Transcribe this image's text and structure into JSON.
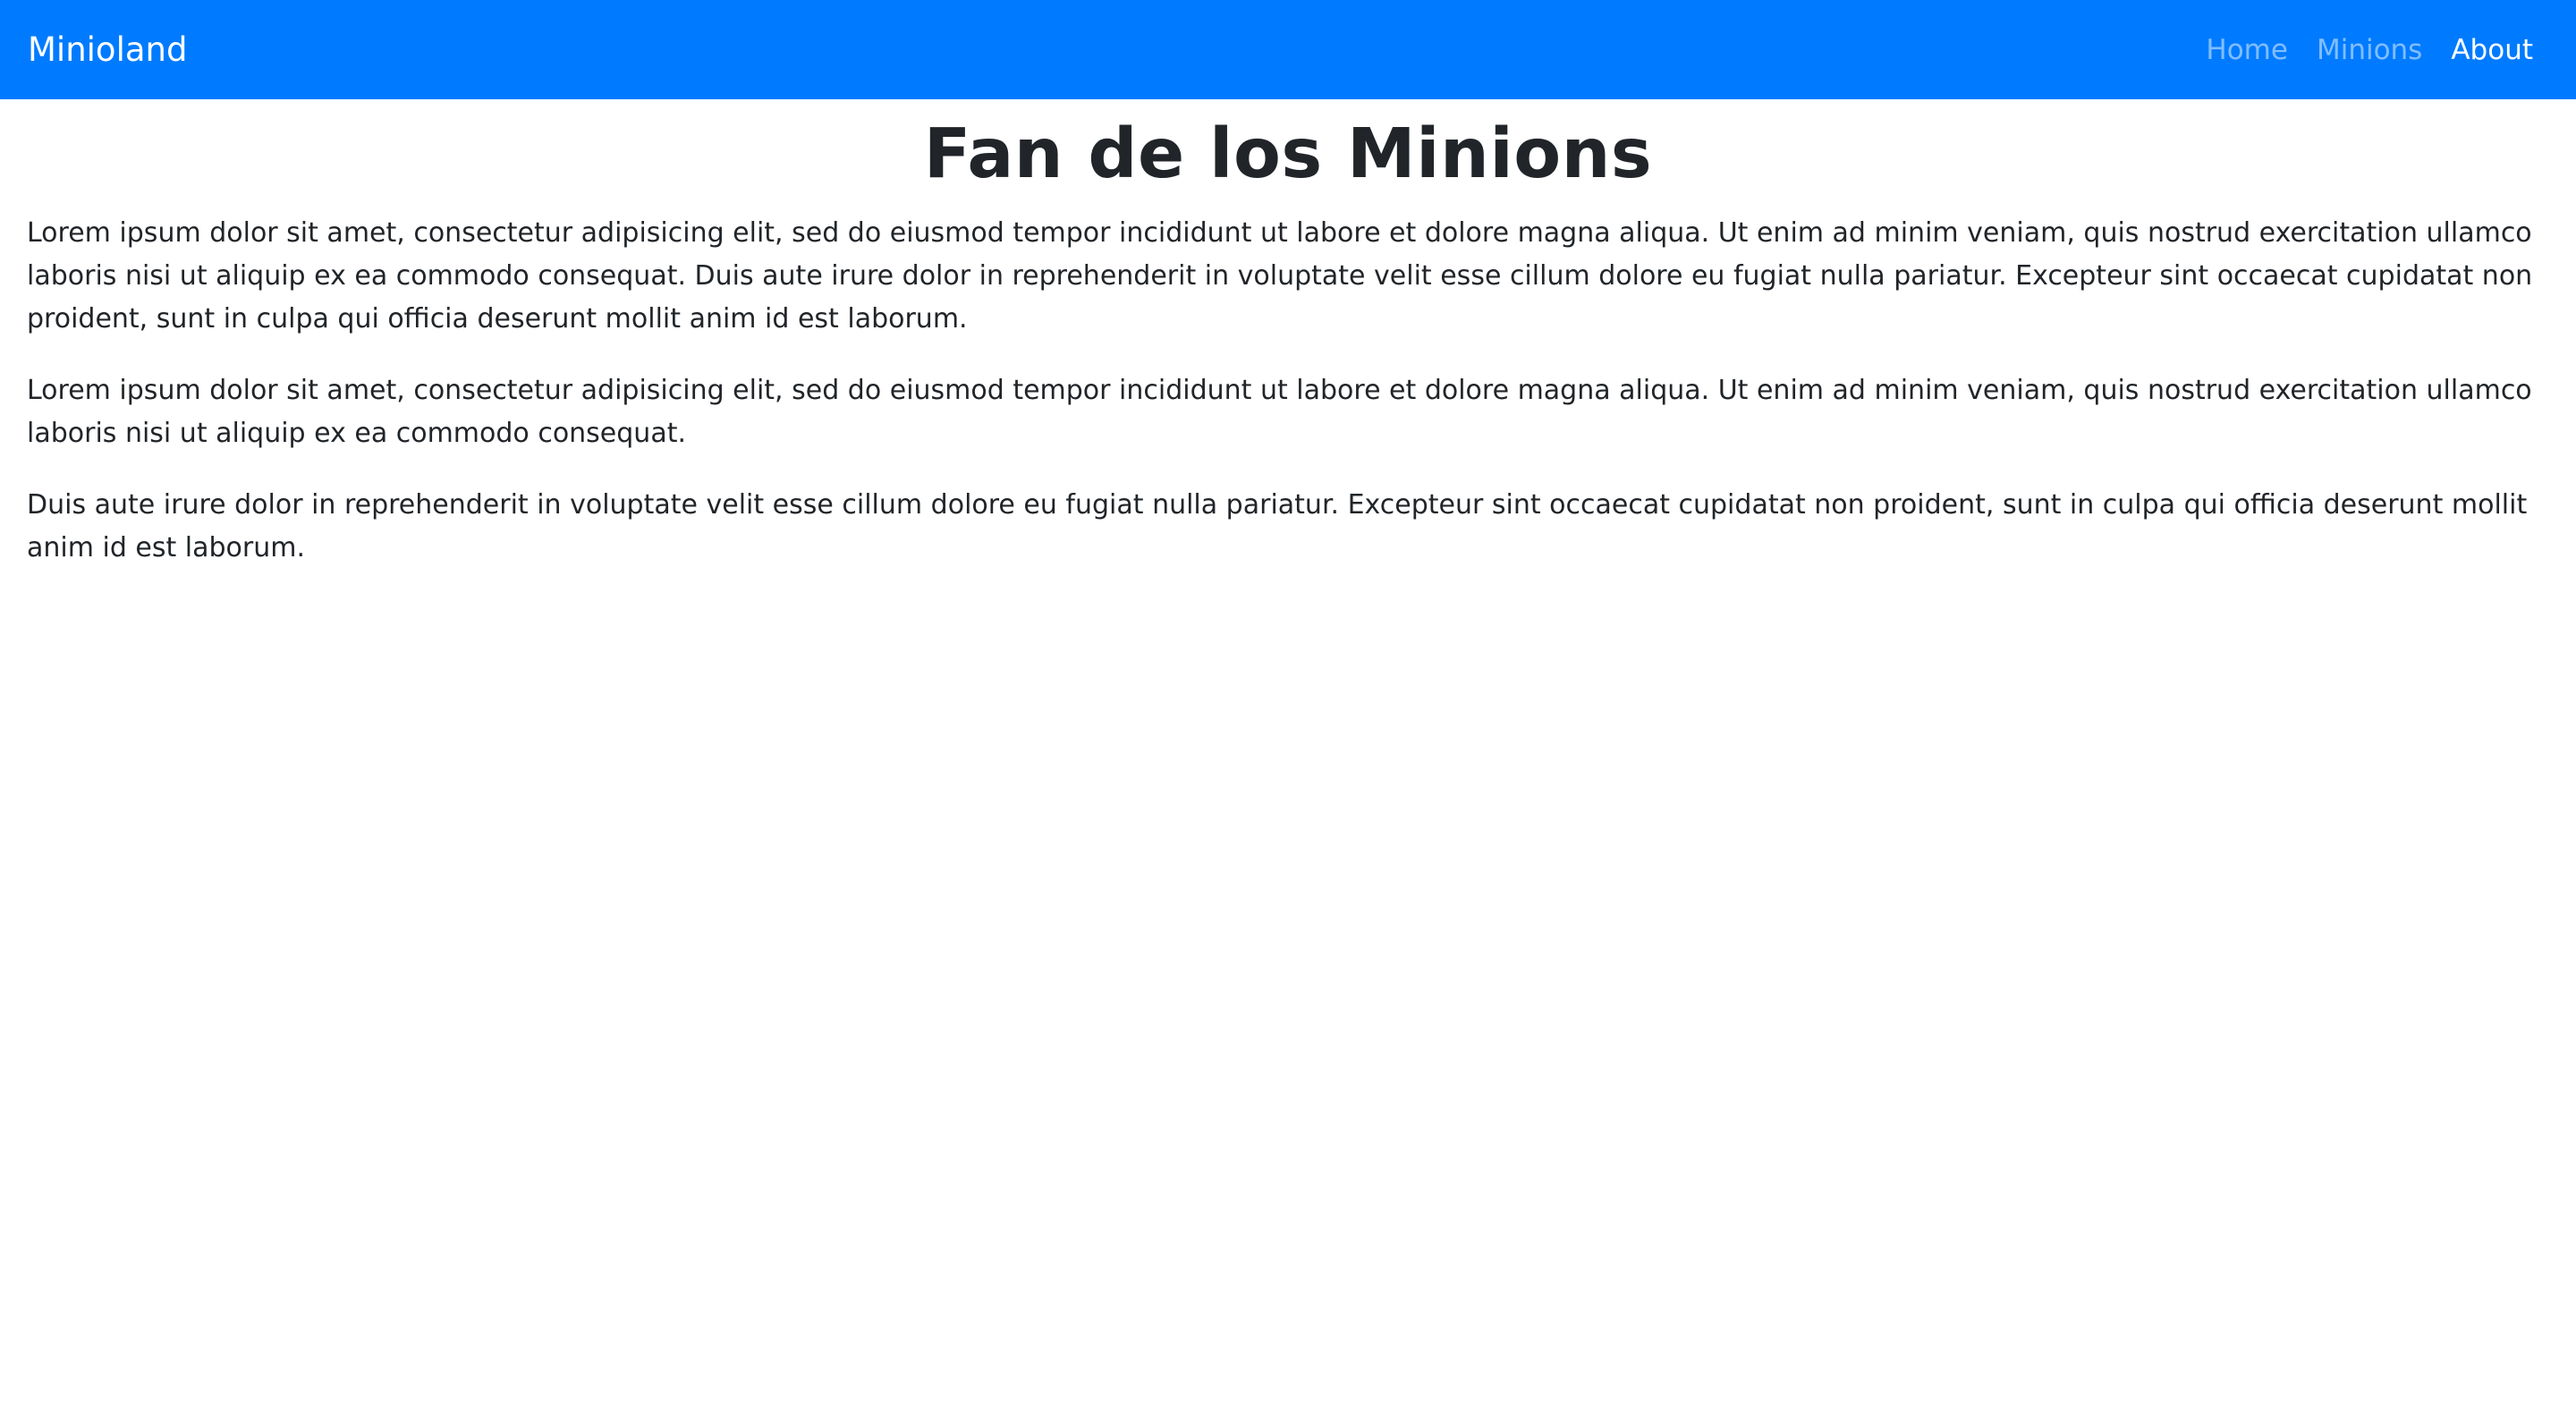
{
  "navbar": {
    "brand": "Minioland",
    "links": [
      {
        "label": "Home",
        "active": false
      },
      {
        "label": "Minions",
        "active": false
      },
      {
        "label": "About",
        "active": true
      }
    ],
    "background": "#007bff"
  },
  "main": {
    "heading": "Fan de los Minions",
    "paragraphs": [
      "Lorem ipsum dolor sit amet, consectetur adipisicing elit, sed do eiusmod tempor incididunt ut labore et dolore magna aliqua. Ut enim ad minim veniam, quis nostrud exercitation ullamco laboris nisi ut aliquip ex ea commodo consequat. Duis aute irure dolor in reprehenderit in voluptate velit esse cillum dolore eu fugiat nulla pariatur. Excepteur sint occaecat cupidatat non proident, sunt in culpa qui officia deserunt mollit anim id est laborum.",
      "Lorem ipsum dolor sit amet, consectetur adipisicing elit, sed do eiusmod tempor incididunt ut labore et dolore magna aliqua. Ut enim ad minim veniam, quis nostrud exercitation ullamco laboris nisi ut aliquip ex ea commodo consequat.",
      "Duis aute irure dolor in reprehenderit in voluptate velit esse cillum dolore eu fugiat nulla pariatur. Excepteur sint occaecat cupidatat non proident, sunt in culpa qui officia deserunt mollit anim id est laborum."
    ]
  }
}
